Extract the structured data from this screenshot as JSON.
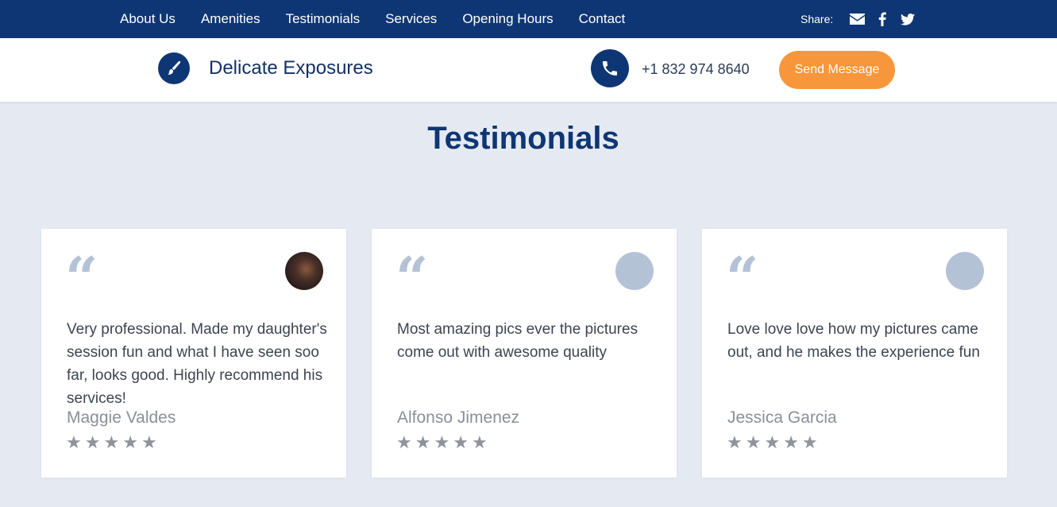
{
  "nav": {
    "items": [
      "About Us",
      "Amenities",
      "Testimonials",
      "Services",
      "Opening Hours",
      "Contact"
    ],
    "share_label": "Share:",
    "share_icons": [
      "envelope-icon",
      "facebook-icon",
      "twitter-icon"
    ]
  },
  "header": {
    "logo_icon": "brush-icon",
    "brand": "Delicate Exposures",
    "phone_icon": "phone-icon",
    "phone": "+1 832 974 8640",
    "send_label": "Send Message"
  },
  "section": {
    "title": "Testimonials"
  },
  "testimonials": [
    {
      "text": "Very professional. Made my daughter's session fun and what I have seen soo far, looks good. Highly recommend his services!",
      "name": "Maggie Valdes",
      "rating": 5,
      "avatar": "photo"
    },
    {
      "text": "Most amazing pics ever the pictures come out with awesome quality",
      "name": "Alfonso Jimenez",
      "rating": 5,
      "avatar": "placeholder"
    },
    {
      "text": "Love love love how my pictures came out, and he makes the experience fun",
      "name": "Jessica Garcia",
      "rating": 5,
      "avatar": "placeholder"
    }
  ],
  "colors": {
    "navy": "#0f3674",
    "accent": "#f8963c",
    "background": "#e5eaf2"
  }
}
